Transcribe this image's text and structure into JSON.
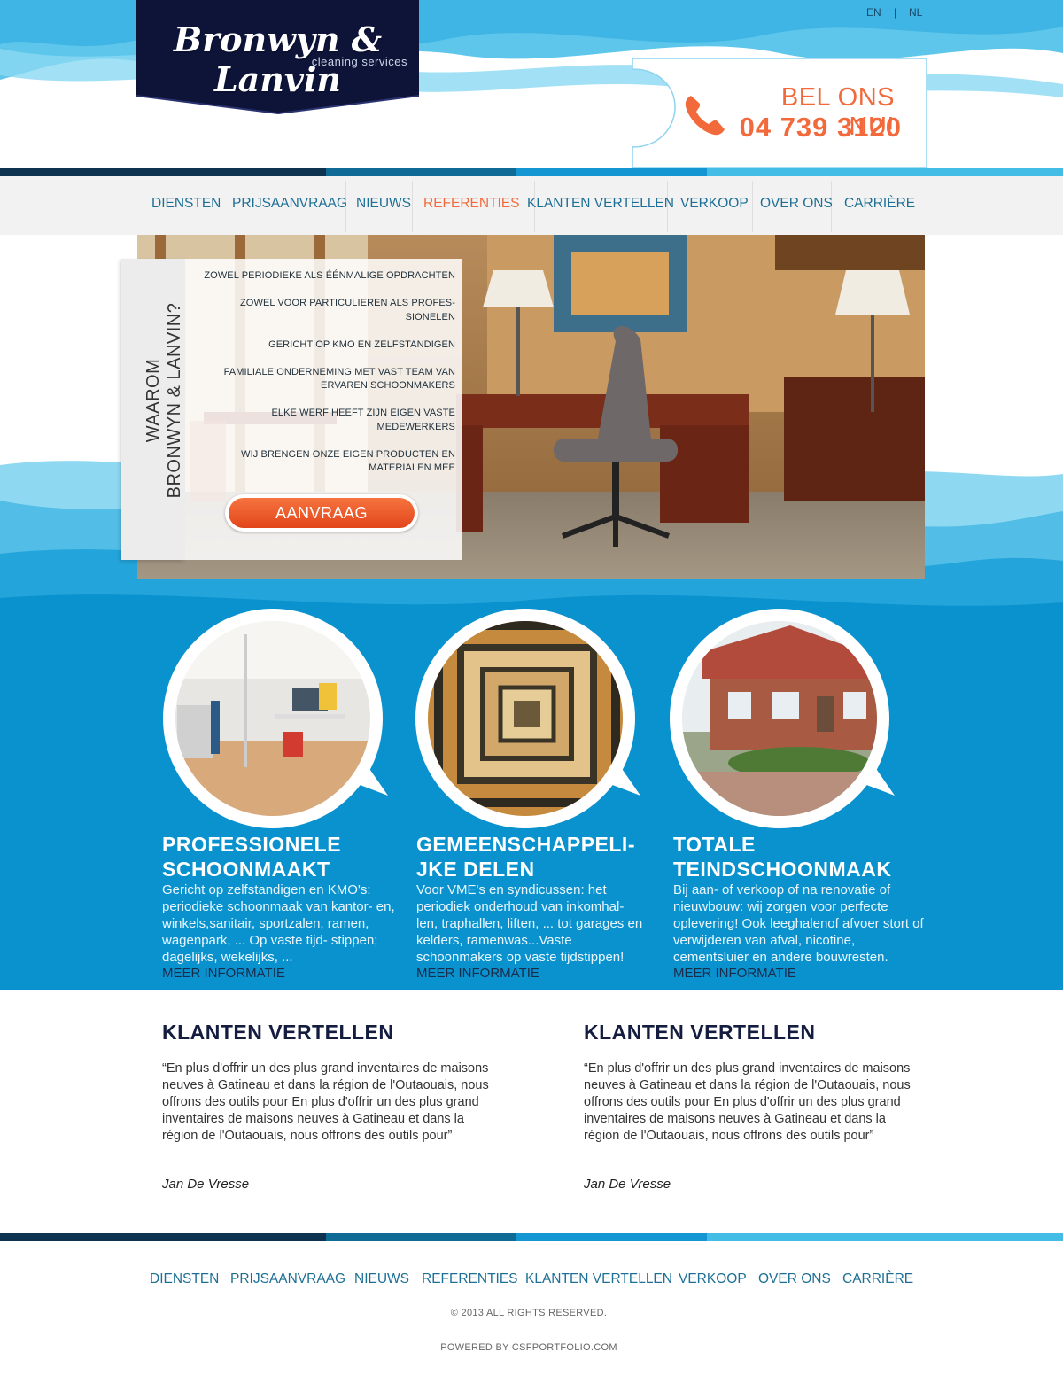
{
  "brand": {
    "name": "Bronwyn & Lanvin",
    "tagline": "cleaning services"
  },
  "languages": {
    "en": "EN",
    "separator": "|",
    "nl": "NL"
  },
  "call": {
    "label": "BEL ONS NU!",
    "number": "04 739 3120"
  },
  "nav": {
    "items": [
      "DIENSTEN",
      "PRIJSAANVRAAG",
      "NIEUWS",
      "REFERENTIES",
      "KLANTEN VERTELLEN",
      "VERKOOP",
      "OVER ONS",
      "CARRIÈRE"
    ],
    "active": "REFERENTIES"
  },
  "why": {
    "title_line1": "WAAROM",
    "title_line2": "BRONWYN & LANVIN?",
    "points": [
      "ZOWEL PERIODIEKE ALS ÉÉNMALIGE OPDRACHTEN",
      "ZOWEL VOOR PARTICULIEREN ALS PROFES- SIONELEN",
      "GERICHT OP KMO EN ZELFSTANDIGEN",
      "FAMILIALE ONDERNEMING MET VAST TEAM VAN ERVAREN SCHOONMAKERS",
      "ELKE WERF HEEFT ZIJN EIGEN VASTE MEDEWERKERS",
      "WIJ BRENGEN ONZE EIGEN PRODUCTEN EN MATERIALEN MEE"
    ],
    "button": "AANVRAAG"
  },
  "services": [
    {
      "title_line1": "PROFESSIONELE",
      "title_line2": "SCHOONMAAKT",
      "text": "Gericht op zelfstandigen en KMO's: periodieke schoonmaak van kantor- en, winkels,sanitair, sportzalen, ramen, wagenpark, ... Op vaste tijd- stippen; dagelijks, wekelijks, ...",
      "more": "MEER INFORMATIE"
    },
    {
      "title_line1": "GEMEENSCHAPPELI-",
      "title_line2": "JKE DELEN",
      "text": "Voor VME's en syndicussen: het periodiek onderhoud van inkomhal- len, traphallen, liften, ... tot garages en kelders, ramenwas...Vaste schoonmakers op vaste tijdstippen!",
      "more": "MEER INFORMATIE"
    },
    {
      "title_line1": "TOTALE",
      "title_line2": "TEINDSCHOONMAAK",
      "text": "Bij aan- of verkoop of na renovatie of nieuwbouw: wij zorgen voor perfecte oplevering!  Ook leeghalenof afvoer stort of verwijderen van afval, nicotine, cementsluier en andere bouwresten.",
      "more": "MEER INFORMATIE"
    }
  ],
  "testimonials": [
    {
      "title": "KLANTEN VERTELLEN",
      "quote": "“En plus d'offrir un des plus grand inventaires de maisons neuves à Gatineau et dans la région de l'Outaouais, nous offrons des outils pour En plus d'offrir un des plus grand inventaires de maisons neuves à Gatineau et dans la région de l'Outaouais, nous offrons des outils pour”",
      "author": "Jan De Vresse"
    },
    {
      "title": "KLANTEN VERTELLEN",
      "quote": "“En plus d'offrir un des plus grand inventaires de maisons neuves à Gatineau et dans la région de l'Outaouais, nous offrons des outils pour En plus d'offrir un des plus grand inventaires de maisons neuves à Gatineau et dans la région de l'Outaouais, nous offrons des outils pour”",
      "author": "Jan De Vresse"
    }
  ],
  "footer": {
    "nav": [
      "DIENSTEN",
      "PRIJSAANVRAAG",
      "NIEUWS",
      "REFERENTIES",
      "KLANTEN VERTELLEN",
      "VERKOOP",
      "OVER ONS",
      "CARRIÈRE"
    ],
    "copyright": "© 2013 ALL RIGHTS RESERVED.",
    "powered": "POWERED BY CSFPORTFOLIO.COM"
  },
  "colors": {
    "accent": "#f26a3b",
    "nav_text": "#1d6f95",
    "services_bg": "#0a92cf",
    "logo_bg": "#0e1338",
    "stripe_1": "#0e3350",
    "stripe_2": "#0f6a96",
    "stripe_3": "#1396d2",
    "stripe_4": "#43bde6"
  },
  "icons": {
    "phone": "phone-icon"
  }
}
